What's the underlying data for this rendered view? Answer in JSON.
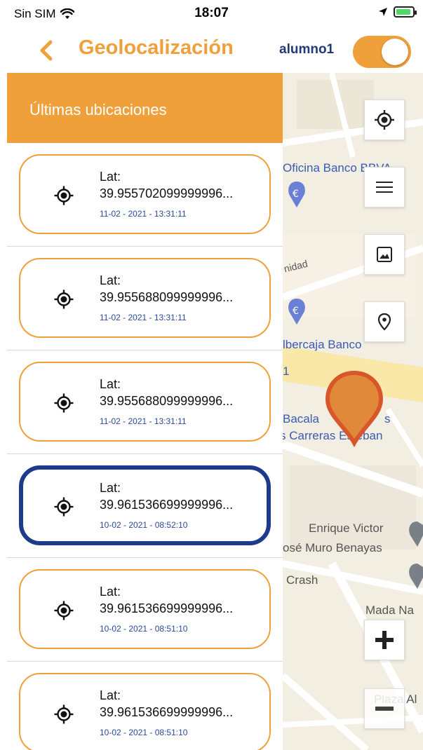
{
  "status_bar": {
    "carrier": "Sin SIM",
    "time": "18:07",
    "battery_color": "#4cd964"
  },
  "header": {
    "back_icon": "chevron-left-icon",
    "title": "Geolocalización",
    "user": "alumno1",
    "toggle_on": true
  },
  "colors": {
    "accent": "#f0a03a",
    "selected_border": "#1e3a8a",
    "date_text": "#2a4a9a",
    "marker": "#e07a3a"
  },
  "panel": {
    "title": "Últimas ubicaciones",
    "items": [
      {
        "lat_label": "Lat:",
        "lat_value": "39.955702099999996...",
        "date": "11-02 - 2021 - 13:31:11",
        "selected": false
      },
      {
        "lat_label": "Lat:",
        "lat_value": "39.955688099999996...",
        "date": "11-02 - 2021 - 13:31:11",
        "selected": false
      },
      {
        "lat_label": "Lat:",
        "lat_value": "39.955688099999996...",
        "date": "11-02 - 2021 - 13:31:11",
        "selected": false
      },
      {
        "lat_label": "Lat:",
        "lat_value": "39.961536699999996...",
        "date": "10-02 - 2021 - 08:52:10",
        "selected": true
      },
      {
        "lat_label": "Lat:",
        "lat_value": "39.961536699999996...",
        "date": "10-02 - 2021 - 08:51:10",
        "selected": false
      },
      {
        "lat_label": "Lat:",
        "lat_value": "39.961536699999996...",
        "date": "10-02 - 2021 - 08:51:10",
        "selected": false
      }
    ]
  },
  "map": {
    "labels": {
      "bbva": "Oficina Banco BBVA",
      "unidad": "nidad",
      "ibercaja": "lbercaja Banco",
      "one": "1",
      "bacala": "Bacala",
      "bacala_tail": "s",
      "carreras": "s Carreras Esteban",
      "enrique": "Enrique Victor",
      "muro": "osé Muro Benayas",
      "crash": "Crash",
      "mada": "Mada Na",
      "plaza": "Plaza Al"
    },
    "controls": [
      "my-location-icon",
      "menu-icon",
      "image-icon",
      "place-icon",
      "zoom-in-icon",
      "zoom-out-icon"
    ]
  }
}
